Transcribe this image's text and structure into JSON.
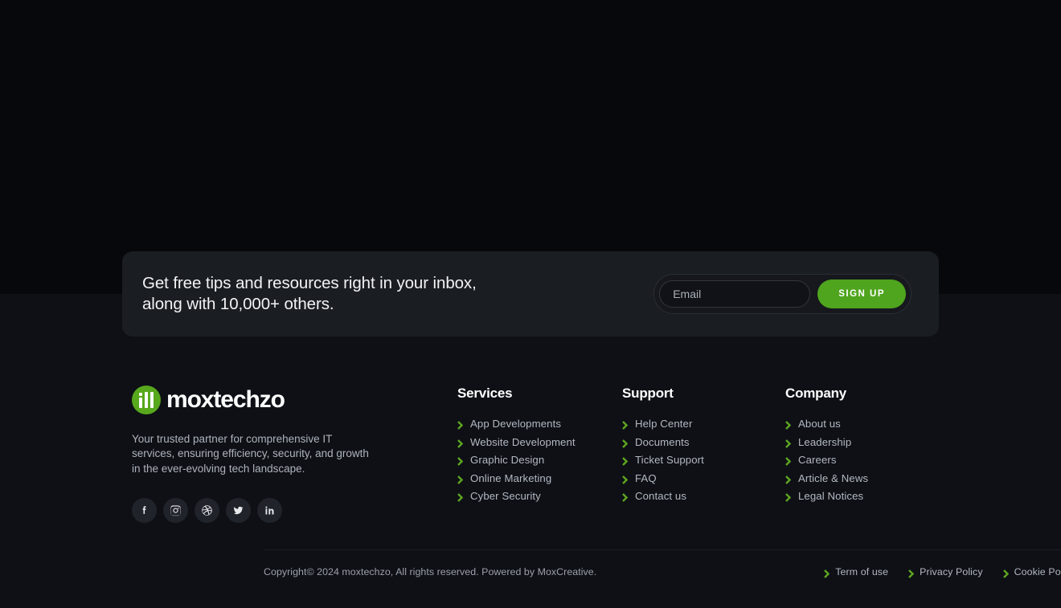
{
  "newsletter": {
    "headline": "Get free tips and resources right in your inbox,\nalong with 10,000+ others.",
    "email_placeholder": "Email",
    "email_value": "",
    "signup_label": "SIGN UP"
  },
  "brand": {
    "name": "moxtechzo",
    "description": "Your trusted partner for comprehensive IT\nservices, ensuring efficiency, security, and growth\nin the ever-evolving tech landscape.",
    "socials": [
      {
        "name": "facebook"
      },
      {
        "name": "instagram"
      },
      {
        "name": "dribbble"
      },
      {
        "name": "twitter"
      },
      {
        "name": "linkedin"
      }
    ]
  },
  "columns": [
    {
      "title": "Services",
      "links": [
        "App Developments",
        "Website Development",
        "Graphic Design",
        "Online Marketing",
        "Cyber Security"
      ]
    },
    {
      "title": "Support",
      "links": [
        "Help Center",
        "Documents",
        "Ticket Support",
        "FAQ",
        "Contact us"
      ]
    },
    {
      "title": "Company",
      "links": [
        "About us",
        "Leadership",
        "Careers",
        "Article & News",
        "Legal Notices"
      ]
    }
  ],
  "bottom": {
    "copyright": "Copyright© 2024 moxtechzo, All rights reserved. Powered by MoxCreative.",
    "legal": [
      "Term of use",
      "Privacy Policy",
      "Cookie Policy"
    ]
  },
  "colors": {
    "accent_green": "#4fa51e",
    "logo_green": "#57a81c",
    "chevron_green": "#5ea520",
    "page_bg_top": "#07080b",
    "page_bg_bottom": "#0e1016",
    "card_bg": "#1a1d22"
  }
}
